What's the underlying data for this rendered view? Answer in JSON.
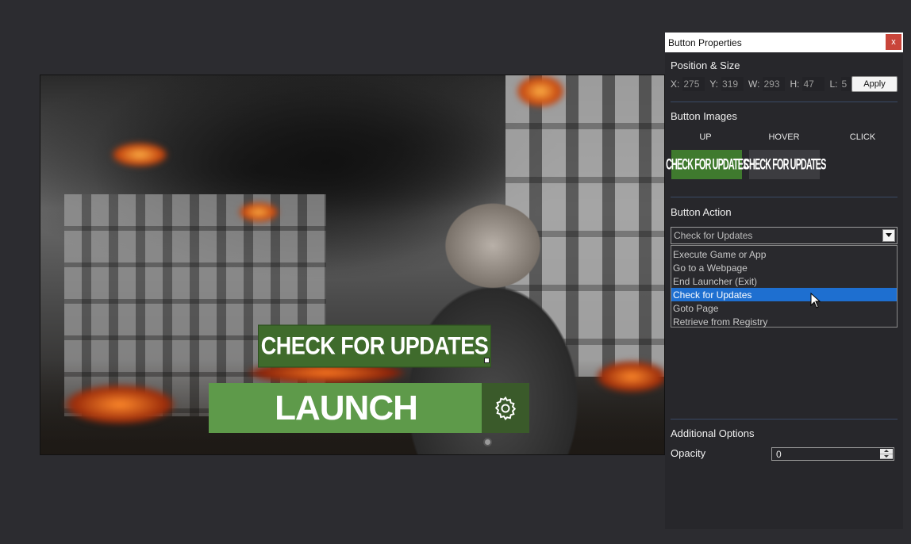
{
  "preview": {
    "updates_button_label": "CHECK FOR UPDATES",
    "launch_button_label": "LAUNCH"
  },
  "panel": {
    "title": "Button Properties",
    "close_label": "x",
    "position_section": {
      "heading": "Position & Size",
      "fields": [
        {
          "label": "X:",
          "value": "275"
        },
        {
          "label": "Y:",
          "value": "319"
        },
        {
          "label": "W:",
          "value": "293"
        },
        {
          "label": "H:",
          "value": "47"
        },
        {
          "label": "L:",
          "value": "5"
        }
      ],
      "apply_label": "Apply"
    },
    "images_section": {
      "heading": "Button Images",
      "states": [
        "UP",
        "HOVER",
        "CLICK"
      ],
      "thumb_text": "CHECK FOR UPDATES"
    },
    "action_section": {
      "heading": "Button Action",
      "selected": "Check for Updates",
      "options": [
        "Execute Game or App",
        "Go to a Webpage",
        "End Launcher (Exit)",
        "Check for Updates",
        "Goto Page",
        "Retrieve from Registry"
      ]
    },
    "additional_section": {
      "heading": "Additional Options",
      "opacity_label": "Opacity",
      "opacity_value": "0"
    }
  }
}
